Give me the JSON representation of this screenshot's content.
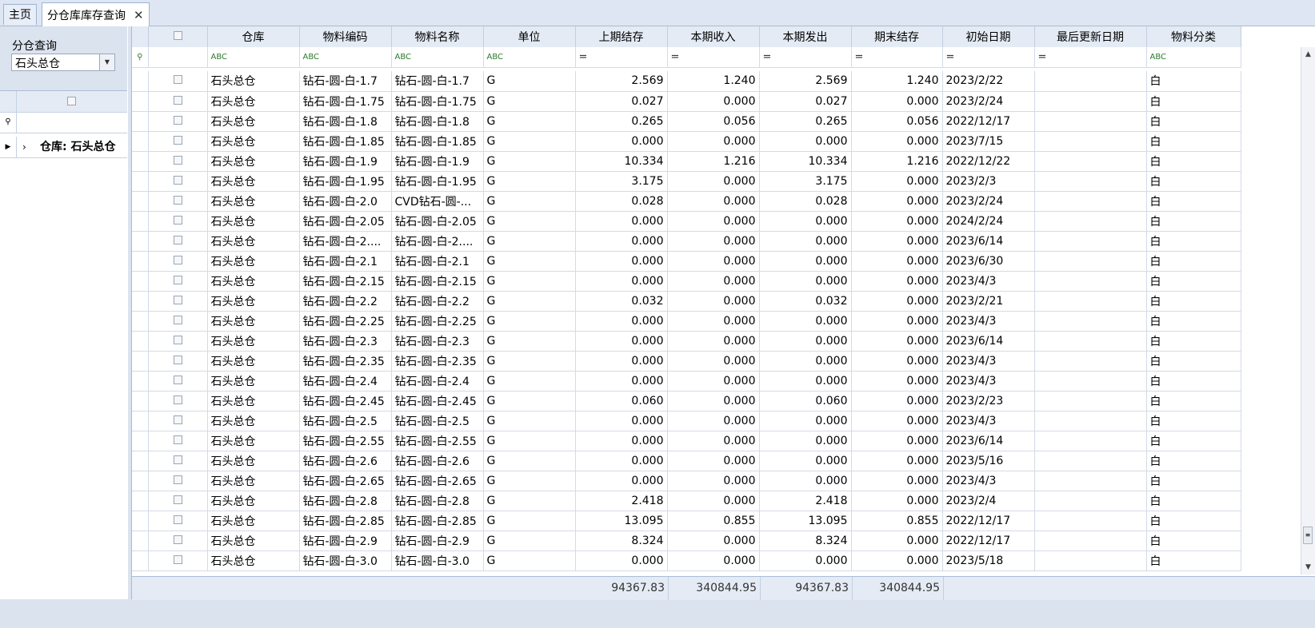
{
  "tabs": [
    {
      "label": "主页",
      "active": false
    },
    {
      "label": "分仓库库存查询",
      "active": true,
      "close": "✕"
    }
  ],
  "left_panel": {
    "filter_label": "分仓查询",
    "warehouse_select": "石头总仓",
    "group_row": "仓库: 石头总仓"
  },
  "columns": [
    "仓库",
    "物料编码",
    "物料名称",
    "单位",
    "上期结存",
    "本期收入",
    "本期发出",
    "期末结存",
    "初始日期",
    "最后更新日期",
    "物料分类"
  ],
  "filter_row": [
    "ABC",
    "ABC",
    "ABC",
    "ABC",
    "=",
    "=",
    "=",
    "=",
    "=",
    "=",
    "ABC"
  ],
  "rows": [
    [
      "石头总仓",
      "钻石-圆-白-1.7",
      "钻石-圆-白-1.7",
      "G",
      "2.569",
      "1.240",
      "2.569",
      "1.240",
      "2023/2/22",
      "",
      "白"
    ],
    [
      "石头总仓",
      "钻石-圆-白-1.75",
      "钻石-圆-白-1.75",
      "G",
      "0.027",
      "0.000",
      "0.027",
      "0.000",
      "2023/2/24",
      "",
      "白"
    ],
    [
      "石头总仓",
      "钻石-圆-白-1.8",
      "钻石-圆-白-1.8",
      "G",
      "0.265",
      "0.056",
      "0.265",
      "0.056",
      "2022/12/17",
      "",
      "白"
    ],
    [
      "石头总仓",
      "钻石-圆-白-1.85",
      "钻石-圆-白-1.85",
      "G",
      "0.000",
      "0.000",
      "0.000",
      "0.000",
      "2023/7/15",
      "",
      "白"
    ],
    [
      "石头总仓",
      "钻石-圆-白-1.9",
      "钻石-圆-白-1.9",
      "G",
      "10.334",
      "1.216",
      "10.334",
      "1.216",
      "2022/12/22",
      "",
      "白"
    ],
    [
      "石头总仓",
      "钻石-圆-白-1.95",
      "钻石-圆-白-1.95",
      "G",
      "3.175",
      "0.000",
      "3.175",
      "0.000",
      "2023/2/3",
      "",
      "白"
    ],
    [
      "石头总仓",
      "钻石-圆-白-2.0",
      "CVD钻石-圆-...",
      "G",
      "0.028",
      "0.000",
      "0.028",
      "0.000",
      "2023/2/24",
      "",
      "白"
    ],
    [
      "石头总仓",
      "钻石-圆-白-2.05",
      "钻石-圆-白-2.05",
      "G",
      "0.000",
      "0.000",
      "0.000",
      "0.000",
      "2024/2/24",
      "",
      "白"
    ],
    [
      "石头总仓",
      "钻石-圆-白-2....",
      "钻石-圆-白-2....",
      "G",
      "0.000",
      "0.000",
      "0.000",
      "0.000",
      "2023/6/14",
      "",
      "白"
    ],
    [
      "石头总仓",
      "钻石-圆-白-2.1",
      "钻石-圆-白-2.1",
      "G",
      "0.000",
      "0.000",
      "0.000",
      "0.000",
      "2023/6/30",
      "",
      "白"
    ],
    [
      "石头总仓",
      "钻石-圆-白-2.15",
      "钻石-圆-白-2.15",
      "G",
      "0.000",
      "0.000",
      "0.000",
      "0.000",
      "2023/4/3",
      "",
      "白"
    ],
    [
      "石头总仓",
      "钻石-圆-白-2.2",
      "钻石-圆-白-2.2",
      "G",
      "0.032",
      "0.000",
      "0.032",
      "0.000",
      "2023/2/21",
      "",
      "白"
    ],
    [
      "石头总仓",
      "钻石-圆-白-2.25",
      "钻石-圆-白-2.25",
      "G",
      "0.000",
      "0.000",
      "0.000",
      "0.000",
      "2023/4/3",
      "",
      "白"
    ],
    [
      "石头总仓",
      "钻石-圆-白-2.3",
      "钻石-圆-白-2.3",
      "G",
      "0.000",
      "0.000",
      "0.000",
      "0.000",
      "2023/6/14",
      "",
      "白"
    ],
    [
      "石头总仓",
      "钻石-圆-白-2.35",
      "钻石-圆-白-2.35",
      "G",
      "0.000",
      "0.000",
      "0.000",
      "0.000",
      "2023/4/3",
      "",
      "白"
    ],
    [
      "石头总仓",
      "钻石-圆-白-2.4",
      "钻石-圆-白-2.4",
      "G",
      "0.000",
      "0.000",
      "0.000",
      "0.000",
      "2023/4/3",
      "",
      "白"
    ],
    [
      "石头总仓",
      "钻石-圆-白-2.45",
      "钻石-圆-白-2.45",
      "G",
      "0.060",
      "0.000",
      "0.060",
      "0.000",
      "2023/2/23",
      "",
      "白"
    ],
    [
      "石头总仓",
      "钻石-圆-白-2.5",
      "钻石-圆-白-2.5",
      "G",
      "0.000",
      "0.000",
      "0.000",
      "0.000",
      "2023/4/3",
      "",
      "白"
    ],
    [
      "石头总仓",
      "钻石-圆-白-2.55",
      "钻石-圆-白-2.55",
      "G",
      "0.000",
      "0.000",
      "0.000",
      "0.000",
      "2023/6/14",
      "",
      "白"
    ],
    [
      "石头总仓",
      "钻石-圆-白-2.6",
      "钻石-圆-白-2.6",
      "G",
      "0.000",
      "0.000",
      "0.000",
      "0.000",
      "2023/5/16",
      "",
      "白"
    ],
    [
      "石头总仓",
      "钻石-圆-白-2.65",
      "钻石-圆-白-2.65",
      "G",
      "0.000",
      "0.000",
      "0.000",
      "0.000",
      "2023/4/3",
      "",
      "白"
    ],
    [
      "石头总仓",
      "钻石-圆-白-2.8",
      "钻石-圆-白-2.8",
      "G",
      "2.418",
      "0.000",
      "2.418",
      "0.000",
      "2023/2/4",
      "",
      "白"
    ],
    [
      "石头总仓",
      "钻石-圆-白-2.85",
      "钻石-圆-白-2.85",
      "G",
      "13.095",
      "0.855",
      "13.095",
      "0.855",
      "2022/12/17",
      "",
      "白"
    ],
    [
      "石头总仓",
      "钻石-圆-白-2.9",
      "钻石-圆-白-2.9",
      "G",
      "8.324",
      "0.000",
      "8.324",
      "0.000",
      "2022/12/17",
      "",
      "白"
    ],
    [
      "石头总仓",
      "钻石-圆-白-3.0",
      "钻石-圆-白-3.0",
      "G",
      "0.000",
      "0.000",
      "0.000",
      "0.000",
      "2023/5/18",
      "",
      "白"
    ]
  ],
  "totals": {
    "prev_balance": "94367.83",
    "income": "340844.95",
    "issued": "94367.83",
    "end_balance": "340844.95"
  }
}
